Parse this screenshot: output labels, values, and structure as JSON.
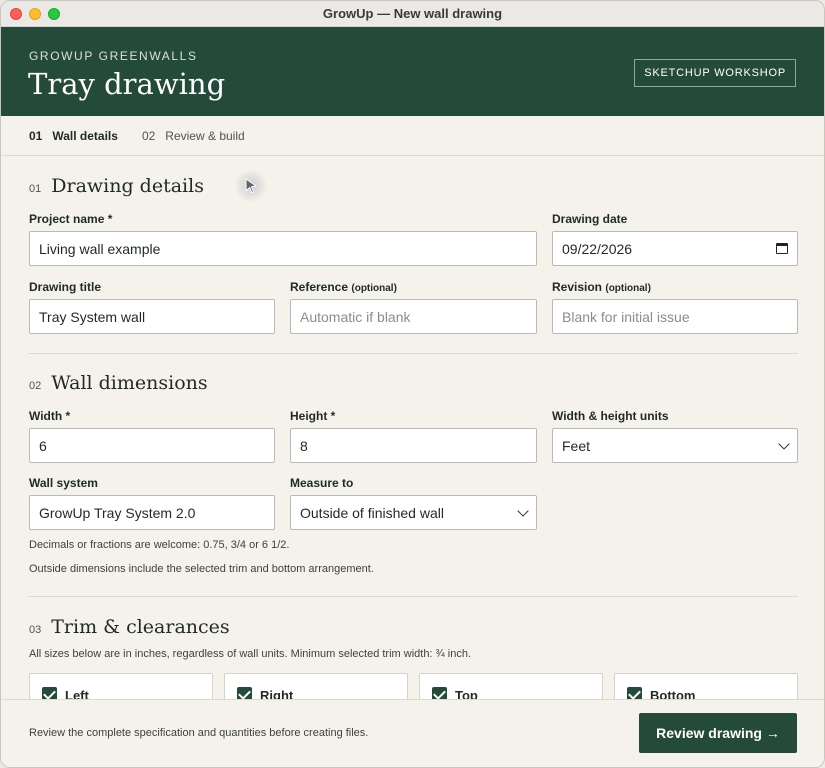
{
  "window": {
    "title": "GrowUp — New wall drawing"
  },
  "banner": {
    "brand": "GROWUP GREENWALLS",
    "title": "Tray drawing",
    "workshop_label": "SKETCHUP WORKSHOP"
  },
  "steps": [
    {
      "num": "01",
      "label": "Wall details",
      "active": true
    },
    {
      "num": "02",
      "label": "Review & build",
      "active": false
    }
  ],
  "sections": {
    "drawing": {
      "num": "01",
      "title": "Drawing details",
      "project_name_label": "Project name *",
      "project_name_value": "Living wall example",
      "drawing_date_label": "Drawing date",
      "drawing_date_value": "09/22/2026",
      "drawing_title_label": "Drawing title",
      "drawing_title_value": "Tray System wall",
      "reference_label": "Reference",
      "reference_optional": "(optional)",
      "reference_placeholder": "Automatic if blank",
      "revision_label": "Revision",
      "revision_optional": "(optional)",
      "revision_placeholder": "Blank for initial issue"
    },
    "dimensions": {
      "num": "02",
      "title": "Wall dimensions",
      "width_label": "Width *",
      "width_value": "6",
      "height_label": "Height *",
      "height_value": "8",
      "units_label": "Width & height units",
      "units_value": "Feet",
      "system_label": "Wall system",
      "system_value": "GrowUp Tray System 2.0",
      "measure_label": "Measure to",
      "measure_value": "Outside of finished wall",
      "note1": "Decimals or fractions are welcome: 0.75, 3/4 or 6 1/2.",
      "note2": "Outside dimensions include the selected trim and bottom arrangement."
    },
    "trim": {
      "num": "03",
      "title": "Trim & clearances",
      "note": "All sizes below are in inches, regardless of wall units. Minimum selected trim width: ¾ inch.",
      "options": [
        "Left",
        "Right",
        "Top",
        "Bottom"
      ]
    }
  },
  "footer": {
    "text": "Review the complete specification and quantities before creating files.",
    "review_label": "Review drawing →"
  }
}
